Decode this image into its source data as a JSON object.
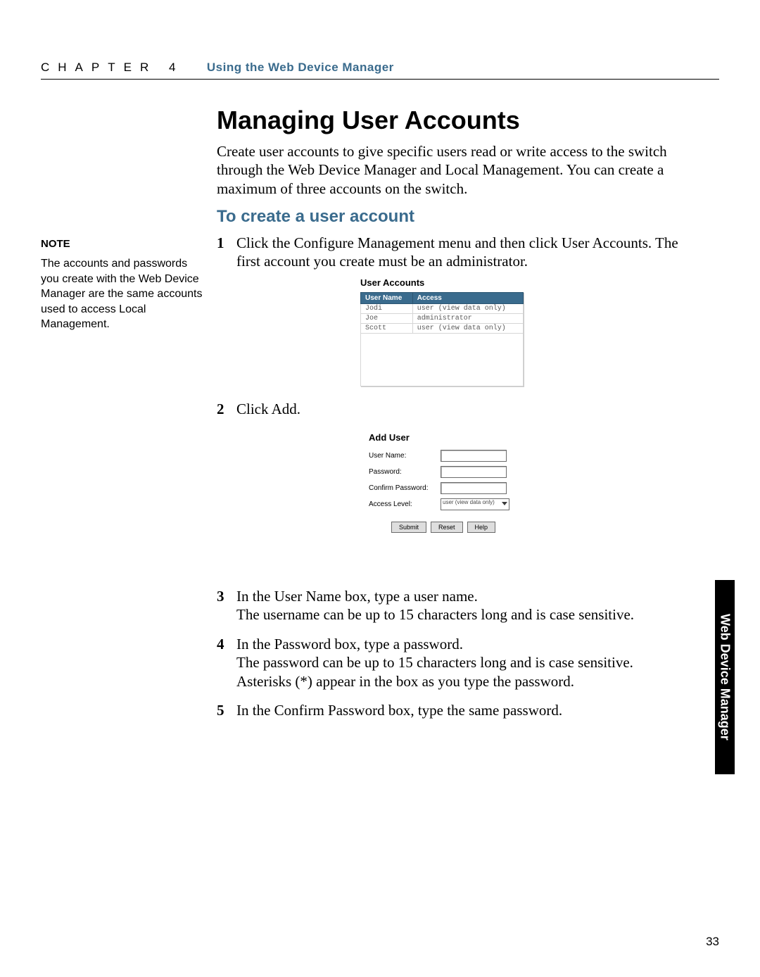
{
  "header": {
    "chapter": "CHAPTER 4",
    "title": "Using the Web Device Manager"
  },
  "h1": "Managing User Accounts",
  "intro": "Create user accounts to give specific users read or write access to the switch through the Web Device Manager and Local Management. You can create a maximum of three accounts on the switch.",
  "h2": "To create a user account",
  "note": {
    "head": "NOTE",
    "body": "The accounts and passwords you create with the Web Device Manager are the same accounts used to access Local Management."
  },
  "steps": {
    "s1": {
      "num": "1",
      "text": "Click the Configure Management menu and then click User Accounts. The first account you create must be an administrator."
    },
    "s2": {
      "num": "2",
      "text": "Click Add."
    },
    "s3": {
      "num": "3",
      "text": "In the User Name box, type a user name.\nThe username can be up to 15 characters long and is case sensitive."
    },
    "s4": {
      "num": "4",
      "text": "In the Password box, type a password.\nThe password can be up to 15 characters long and is case sensitive. Asterisks (*) appear in the box as you type the password."
    },
    "s5": {
      "num": "5",
      "text": "In the Confirm Password box, type the same password."
    }
  },
  "shot1": {
    "title": "User Accounts",
    "cols": {
      "c0": "User Name",
      "c1": "Access"
    },
    "rows": [
      {
        "name": "Jodi",
        "access": "user (view data only)"
      },
      {
        "name": "Joe",
        "access": "administrator"
      },
      {
        "name": "Scott",
        "access": "user (view data only)"
      }
    ]
  },
  "shot2": {
    "title": "Add User",
    "labels": {
      "user": "User Name:",
      "pass": "Password:",
      "confirm": "Confirm Password:",
      "level": "Access Level:"
    },
    "level_value": "user (view data only)",
    "buttons": {
      "submit": "Submit",
      "reset": "Reset",
      "help": "Help"
    }
  },
  "sidetab": "Web Device Manager",
  "pagenum": "33"
}
